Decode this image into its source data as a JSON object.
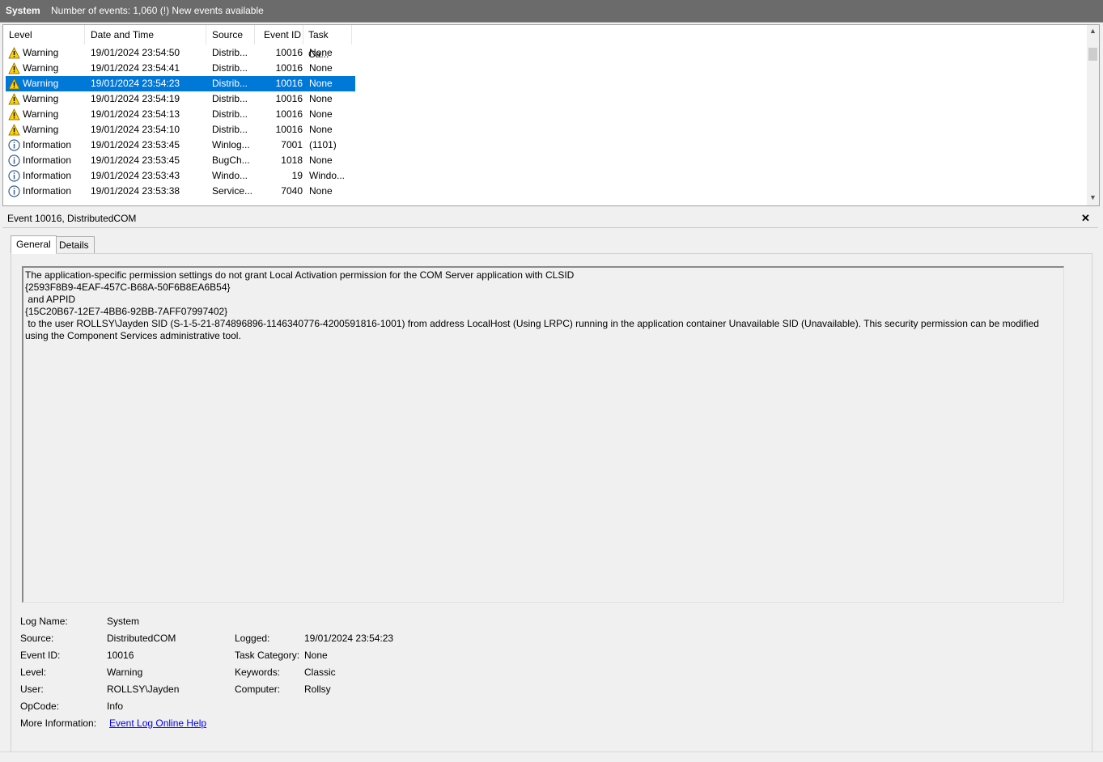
{
  "titlebar": {
    "log": "System",
    "info": "Number of events: 1,060 (!) New events available"
  },
  "columns": [
    "Level",
    "Date and Time",
    "Source",
    "Event ID",
    "Task Ca..."
  ],
  "events": [
    {
      "level": "Warning",
      "icon": "warning-icon",
      "datetime": "19/01/2024 23:54:50",
      "source": "Distrib...",
      "event_id": "10016",
      "task": "None"
    },
    {
      "level": "Warning",
      "icon": "warning-icon",
      "datetime": "19/01/2024 23:54:41",
      "source": "Distrib...",
      "event_id": "10016",
      "task": "None"
    },
    {
      "level": "Warning",
      "icon": "warning-icon",
      "datetime": "19/01/2024 23:54:23",
      "source": "Distrib...",
      "event_id": "10016",
      "task": "None",
      "selected": true
    },
    {
      "level": "Warning",
      "icon": "warning-icon",
      "datetime": "19/01/2024 23:54:19",
      "source": "Distrib...",
      "event_id": "10016",
      "task": "None"
    },
    {
      "level": "Warning",
      "icon": "warning-icon",
      "datetime": "19/01/2024 23:54:13",
      "source": "Distrib...",
      "event_id": "10016",
      "task": "None"
    },
    {
      "level": "Warning",
      "icon": "warning-icon",
      "datetime": "19/01/2024 23:54:10",
      "source": "Distrib...",
      "event_id": "10016",
      "task": "None"
    },
    {
      "level": "Information",
      "icon": "info-icon",
      "datetime": "19/01/2024 23:53:45",
      "source": "Winlog...",
      "event_id": "7001",
      "task": "(1101)"
    },
    {
      "level": "Information",
      "icon": "info-icon",
      "datetime": "19/01/2024 23:53:45",
      "source": "BugCh...",
      "event_id": "1018",
      "task": "None"
    },
    {
      "level": "Information",
      "icon": "info-icon",
      "datetime": "19/01/2024 23:53:43",
      "source": "Windo...",
      "event_id": "19",
      "task": "Windo..."
    },
    {
      "level": "Information",
      "icon": "info-icon",
      "datetime": "19/01/2024 23:53:38",
      "source": "Service...",
      "event_id": "7040",
      "task": "None"
    }
  ],
  "detail": {
    "title": "Event 10016, DistributedCOM",
    "close": "✕",
    "tabs": [
      "General",
      "Details"
    ],
    "message": "The application-specific permission settings do not grant Local Activation permission for the COM Server application with CLSID \n{2593F8B9-4EAF-457C-B68A-50F6B8EA6B54}\n and APPID \n{15C20B67-12E7-4BB6-92BB-7AFF07997402}\n to the user ROLLSY\\Jayden SID (S-1-5-21-874896896-1146340776-4200591816-1001) from address LocalHost (Using LRPC) running in the application container Unavailable SID (Unavailable). This security permission can be modified using the Component Services administrative tool.",
    "props": {
      "log_name_label": "Log Name:",
      "log_name": "System",
      "source_label": "Source:",
      "source": "DistributedCOM",
      "event_id_label": "Event ID:",
      "event_id": "10016",
      "level_label": "Level:",
      "level": "Warning",
      "user_label": "User:",
      "user": "ROLLSY\\Jayden",
      "opcode_label": "OpCode:",
      "opcode": "Info",
      "more_info_label": "More Information:",
      "more_info_link": "Event Log Online Help",
      "logged_label": "Logged:",
      "logged": "19/01/2024 23:54:23",
      "task_category_label": "Task Category:",
      "task_category": "None",
      "keywords_label": "Keywords:",
      "keywords": "Classic",
      "computer_label": "Computer:",
      "computer": "Rollsy"
    }
  },
  "colors": {
    "titlebar_bg": "#6b6b6b",
    "selection": "#0078d7",
    "link": "#0000ee",
    "warning": "#ffd200",
    "info_border": "#3a5f8a"
  }
}
